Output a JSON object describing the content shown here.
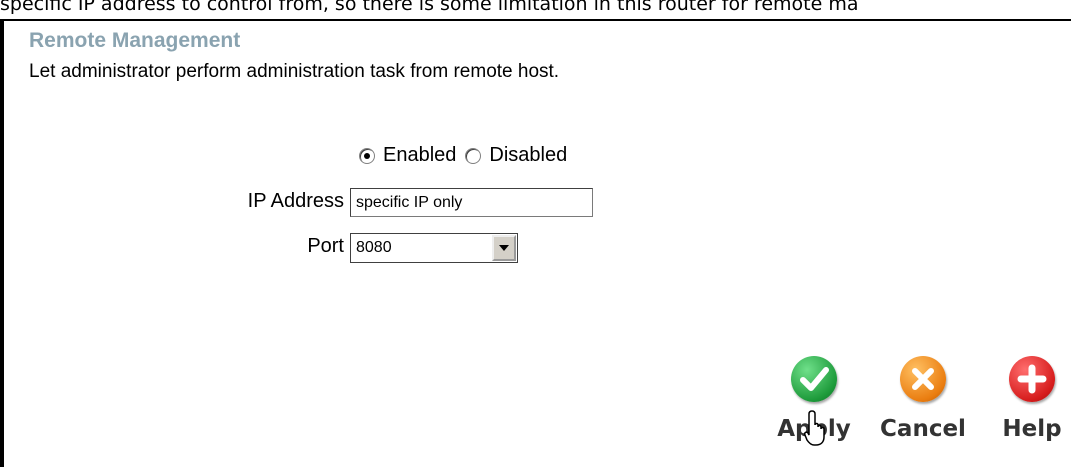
{
  "top_caption": "specific IP address to control from, so there is some limitation in this router for remote ma",
  "section": {
    "title": "Remote Management",
    "description": "Let administrator perform administration task from remote host."
  },
  "mode": {
    "options": [
      "Enabled",
      "Disabled"
    ],
    "selected": "Enabled"
  },
  "ip_address": {
    "label": "IP Address",
    "value": "specific IP only"
  },
  "port": {
    "label": "Port",
    "value": "8080"
  },
  "actions": {
    "apply": "Apply",
    "cancel": "Cancel",
    "help": "Help"
  },
  "colors": {
    "title": "#8aa3b0",
    "apply": "#1d9a3a",
    "cancel": "#ea7d10",
    "help": "#d61c1c"
  },
  "icons": {
    "apply": "checkmark-icon",
    "cancel": "x-icon",
    "help": "plus-icon",
    "cursor": "hand-pointer-icon"
  }
}
